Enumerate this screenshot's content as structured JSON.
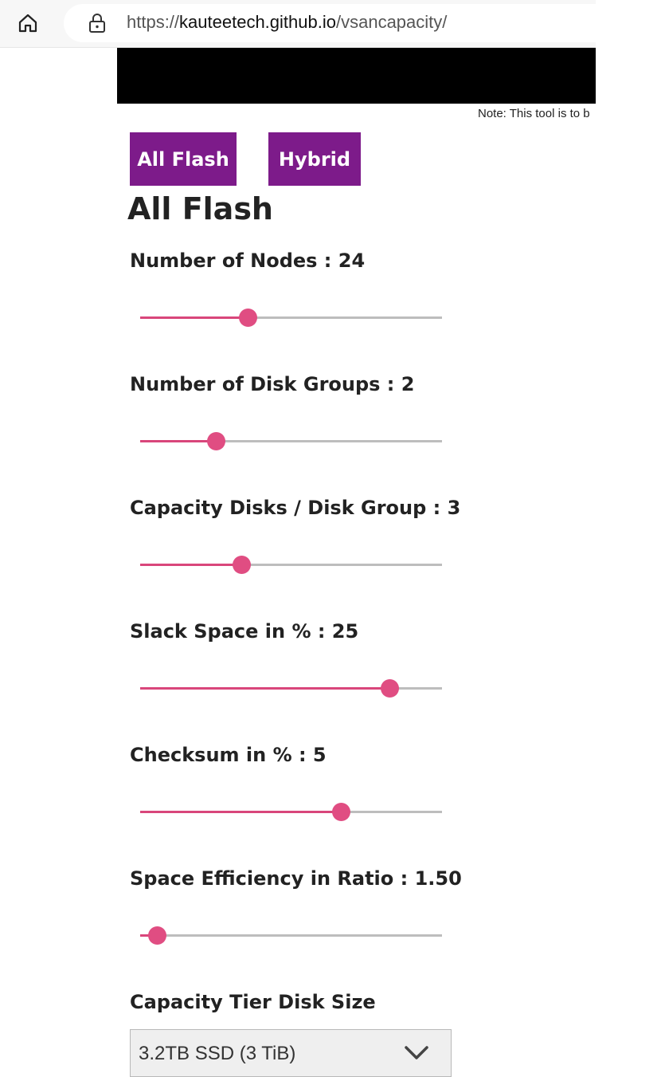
{
  "browser": {
    "url_prefix": "https://",
    "url_host": "kauteetech.github.io",
    "url_path": "/vsancapacity/"
  },
  "page": {
    "note": "Note: This tool is to b",
    "buttons": {
      "all_flash": "All Flash",
      "hybrid": "Hybrid"
    },
    "section_title": "All Flash",
    "fields": [
      {
        "label": "Number of Nodes : 24",
        "slider_fraction": 0.355
      },
      {
        "label": "Number of Disk Groups : 2",
        "slider_fraction": 0.25
      },
      {
        "label": "Capacity Disks / Disk Group : 3",
        "slider_fraction": 0.335
      },
      {
        "label": "Slack Space in % : 25",
        "slider_fraction": 0.825
      },
      {
        "label": "Checksum in % : 5",
        "slider_fraction": 0.665
      },
      {
        "label": "Space Efficiency in Ratio : 1.50",
        "slider_fraction": 0.055
      }
    ],
    "disk_size": {
      "label": "Capacity Tier Disk Size",
      "selected": "3.2TB SSD (3 TiB)"
    }
  },
  "colors": {
    "button_bg": "#7d1b8a",
    "slider_accent": "#e04d82",
    "banner": "#000000"
  }
}
